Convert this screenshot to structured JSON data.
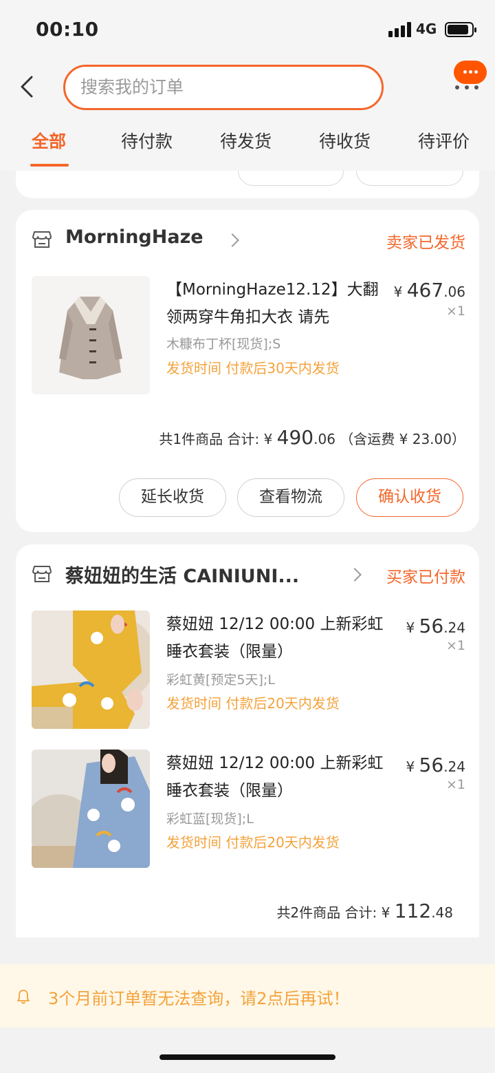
{
  "status_bar": {
    "time": "00:10",
    "network": "4G"
  },
  "header": {
    "search_placeholder": "搜索我的订单"
  },
  "tabs": [
    {
      "label": "全部",
      "active": true
    },
    {
      "label": "待付款"
    },
    {
      "label": "待发货"
    },
    {
      "label": "待收货"
    },
    {
      "label": "待评价"
    }
  ],
  "orders": [
    {
      "shop": "MorningHaze",
      "status": "卖家已发货",
      "items": [
        {
          "title": "【MorningHaze12.12】大翻领两穿牛角扣大衣 请先",
          "sku": "木糠布丁杯[现货];S",
          "ship": "发货时间  付款后30天内发货",
          "price_int": "467",
          "price_dec": ".06",
          "qty": "×1"
        }
      ],
      "summary": {
        "count": "共1件商品",
        "label": "合计:",
        "amount_int": "490",
        "amount_dec": ".06",
        "shipping": "（含运费 ¥ 23.00）"
      },
      "buttons": [
        "延长收货",
        "查看物流",
        "确认收货"
      ]
    },
    {
      "shop": "蔡妞妞的生活 CAINIUNI...",
      "status": "买家已付款",
      "items": [
        {
          "title": "蔡妞妞 12/12 00:00 上新彩虹睡衣套装（限量）",
          "sku": "彩虹黄[预定5天];L",
          "ship": "发货时间  付款后20天内发货",
          "price_int": "56",
          "price_dec": ".24",
          "qty": "×1"
        },
        {
          "title": "蔡妞妞 12/12 00:00 上新彩虹睡衣套装（限量）",
          "sku": "彩虹蓝[现货];L",
          "ship": "发货时间  付款后20天内发货",
          "price_int": "56",
          "price_dec": ".24",
          "qty": "×1"
        }
      ],
      "summary": {
        "count": "共2件商品",
        "label": "合计:",
        "amount_int": "112",
        "amount_dec": ".48"
      }
    }
  ],
  "currency": "¥",
  "notice": "3个月前订单暂无法查询，请2点后再试！",
  "colors": {
    "accent": "#f4662a",
    "ship_text": "#f4a23a",
    "notice_bg": "#fff8e8"
  }
}
